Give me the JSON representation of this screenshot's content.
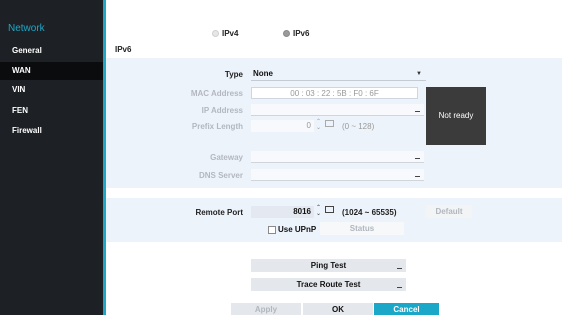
{
  "sidebar": {
    "title": "Network",
    "items": [
      {
        "label": "General"
      },
      {
        "label": "WAN"
      },
      {
        "label": "VIN"
      },
      {
        "label": "FEN"
      },
      {
        "label": "Firewall"
      }
    ]
  },
  "protocol": {
    "options": [
      "IPv4",
      "IPv6"
    ],
    "selected": "IPv6"
  },
  "section_label": "IPv6",
  "form": {
    "type_label": "Type",
    "type_value": "None",
    "mac_label": "MAC Address",
    "mac_value": "00 : 03 : 22 : 5B : F0 : 6F",
    "ip_label": "IP Address",
    "prefix_label": "Prefix Length",
    "prefix_value": "0",
    "prefix_range": "(0 ~ 128)",
    "gateway_label": "Gateway",
    "dns_label": "DNS Server",
    "status_box": "Not ready"
  },
  "remote": {
    "label": "Remote Port",
    "value": "8016",
    "range": "(1024 ~ 65535)",
    "default_button": "Default",
    "upnp_label": "Use UPnP",
    "status_button": "Status"
  },
  "tests": {
    "ping": "Ping Test",
    "trace": "Trace Route Test"
  },
  "footer": {
    "apply": "Apply",
    "ok": "OK",
    "cancel": "Cancel"
  },
  "colors": {
    "accent": "#1ea7c7",
    "sidebar_bg": "#1d2125",
    "panel_bg": "#edf3fb",
    "cancel_bg": "#1ba7c8"
  }
}
